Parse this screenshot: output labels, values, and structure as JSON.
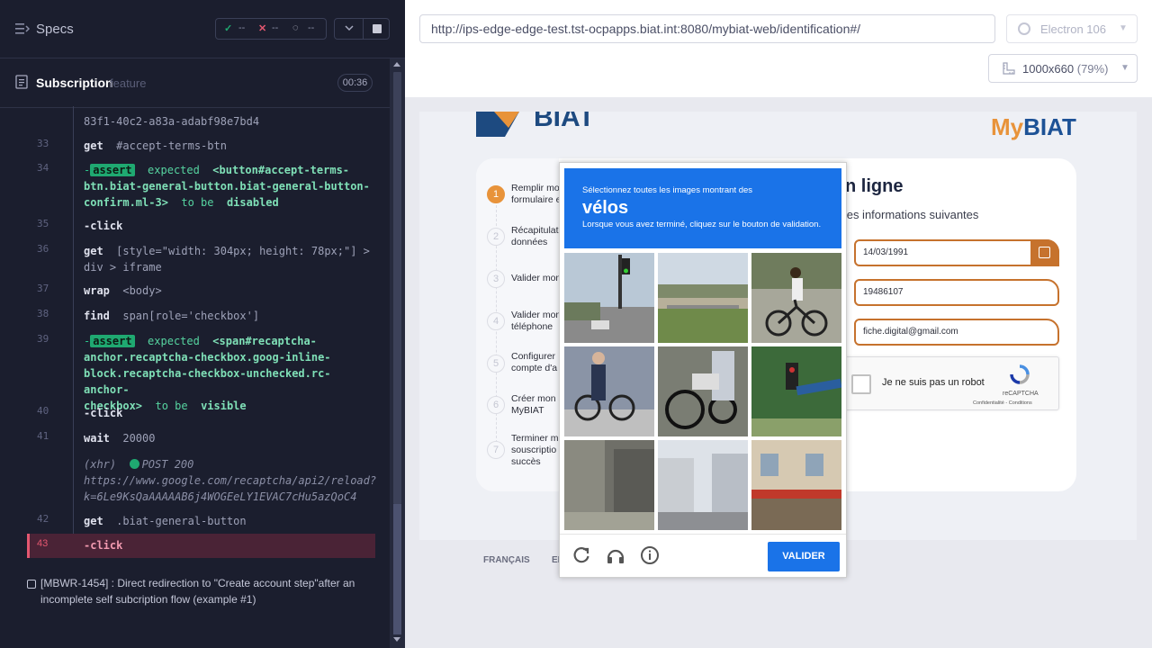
{
  "runner": {
    "specs_label": "Specs",
    "stats": {
      "passed": "--",
      "failed": "--",
      "pending": "--"
    },
    "feature": {
      "title": "Subscription",
      "tag": "feature",
      "duration": "00:36"
    },
    "log": {
      "wrapped_prev": "83f1-40c2-a83a-adabf98e7bd4",
      "l33": {
        "num": "33",
        "cmd": "get",
        "arg": "#accept-terms-btn"
      },
      "l34": {
        "num": "34",
        "badge": "assert",
        "expected": "expected",
        "elem1": "<button#accept-terms-",
        "elem2": "btn.biat-general-button.biat-general-button-",
        "elem3": "confirm.ml-3>",
        "tobe": "to be",
        "state": "disabled"
      },
      "l35": {
        "num": "35",
        "cmd": "-click"
      },
      "l36": {
        "num": "36",
        "cmd": "get",
        "arg1": "[style=\"width: 304px; height: 78px;\"] >",
        "arg2": "div > iframe"
      },
      "l37": {
        "num": "37",
        "cmd": "wrap",
        "arg": "<body>"
      },
      "l38": {
        "num": "38",
        "cmd": "find",
        "arg": "span[role='checkbox']"
      },
      "l39": {
        "num": "39",
        "badge": "assert",
        "expected": "expected",
        "elem1": "<span#recaptcha-",
        "elem2": "anchor.recaptcha-checkbox.goog-inline-",
        "elem3": "block.recaptcha-checkbox-unchecked.rc-anchor-",
        "elem4": "checkbox>",
        "tobe": "to be",
        "state": "visible"
      },
      "l40": {
        "num": "40",
        "cmd": "-click"
      },
      "l41": {
        "num": "41",
        "cmd": "wait",
        "arg": "20000"
      },
      "xhr": {
        "kind": "(xhr)",
        "status": "POST 200",
        "url1": "https://www.google.com/recaptcha/api2/reload?",
        "url2": "k=6Le9KsQaAAAAAB6j4WOGEeLY1EVAC7cHu5azQoC4"
      },
      "l42": {
        "num": "42",
        "cmd": "get",
        "arg": ".biat-general-button"
      },
      "l43": {
        "num": "43",
        "cmd": "-click"
      }
    },
    "test_title": "[MBWR-1454] : Direct redirection to \"Create account step\"after an incomplete self subcription flow (example #1)"
  },
  "aut_header": {
    "url": "http://ips-edge-edge-test.tst-ocpapps.biat.int:8080/mybiat-web/identification#/",
    "browser": "Electron 106",
    "viewport": "1000x660",
    "zoom": "(79%)"
  },
  "app": {
    "brand_my": "My",
    "brand_biat": "BIAT",
    "logo_text": "BIAT",
    "form_title": "n ligne",
    "form_subtitle": "ir les informations suivantes",
    "steps": [
      {
        "num": "1",
        "line1": "Remplir mo",
        "line2": "formulaire e"
      },
      {
        "num": "2",
        "line1": "Récapitulat",
        "line2": "données"
      },
      {
        "num": "3",
        "line1": "Valider mon",
        "line2": ""
      },
      {
        "num": "4",
        "line1": "Valider mon",
        "line2": "téléphone"
      },
      {
        "num": "5",
        "line1": "Configurer",
        "line2": "compte d'a"
      },
      {
        "num": "6",
        "line1": "Créer mon a",
        "line2": "MyBIAT"
      },
      {
        "num": "7",
        "line1": "Terminer m",
        "line2": "souscriptio",
        "line3": "succès"
      }
    ],
    "fields": {
      "birth_date": "14/03/1991",
      "id_number": "19486107",
      "email": "fiche.digital@gmail.com"
    },
    "recaptcha": {
      "label": "Je ne suis pas un robot",
      "brand": "reCAPTCHA",
      "links": "Confidentialité - Conditions"
    },
    "footer": {
      "lang_fr": "FRANÇAIS",
      "lang_en": "EN"
    }
  },
  "challenge": {
    "line1": "Sélectionnez toutes les images montrant des",
    "keyword": "vélos",
    "line2": "Lorsque vous avez terminé, cliquez sur le bouton de validation.",
    "verify_label": "VALIDER",
    "icons": [
      "reload-icon",
      "audio-icon",
      "info-icon"
    ]
  },
  "colors": {
    "accent_orange": "#c6722d",
    "recaptcha_blue": "#1a73e8",
    "assert_green": "#1fa971",
    "fail_red": "#e45770"
  }
}
